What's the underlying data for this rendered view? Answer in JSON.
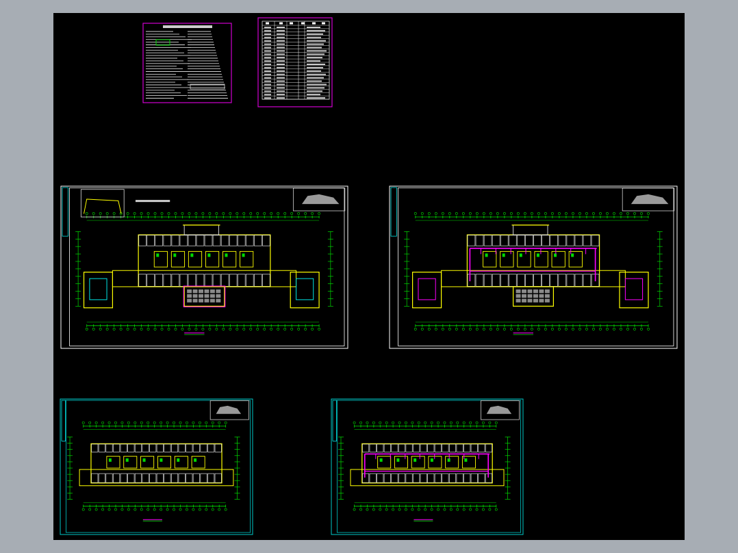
{
  "viewer": {
    "background_color": "#a7adb4",
    "canvas_color": "#000000"
  },
  "colors": {
    "frame_white": "#ffffff",
    "frame_cyan": "#00c8c8",
    "frame_magenta": "#d000d0",
    "wall_yellow": "#ffff00",
    "dim_green": "#00dd00",
    "pipe_magenta": "#ff00ff",
    "grid_cyan": "#00e5e5",
    "hatch_gray": "#8a8a8a",
    "text_white": "#e8e8e8"
  },
  "sheets": [
    {
      "id": "notes-sheet",
      "kind": "notes",
      "frame": "frame_magenta"
    },
    {
      "id": "legend-sheet",
      "kind": "legend",
      "frame": "frame_magenta"
    },
    {
      "id": "plan-1",
      "kind": "floor-plan-large",
      "frame": "frame_white",
      "piping": false
    },
    {
      "id": "plan-2",
      "kind": "floor-plan-large",
      "frame": "frame_white",
      "piping": true
    },
    {
      "id": "plan-3",
      "kind": "floor-plan-small",
      "frame": "frame_cyan",
      "piping": false
    },
    {
      "id": "plan-4",
      "kind": "floor-plan-small",
      "frame": "frame_cyan",
      "piping": true
    }
  ],
  "icons": {
    "key_plan": "key-plan-icon",
    "north": "north-arrow-icon"
  }
}
